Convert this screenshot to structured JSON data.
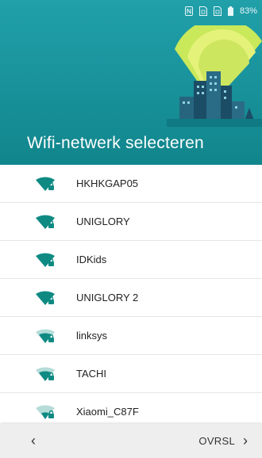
{
  "status_bar": {
    "battery_percent": "83%",
    "icons": [
      "nfc-icon",
      "sim-card-icon",
      "sim-card-icon",
      "battery-icon"
    ]
  },
  "header": {
    "title": "Wifi-netwerk selecteren",
    "background_color": "#1a96a0"
  },
  "networks": [
    {
      "ssid": "HKHKGAP05",
      "locked": true,
      "signal": 4
    },
    {
      "ssid": "UNIGLORY",
      "locked": true,
      "signal": 4
    },
    {
      "ssid": "IDKids",
      "locked": true,
      "signal": 4
    },
    {
      "ssid": "UNIGLORY 2",
      "locked": true,
      "signal": 4
    },
    {
      "ssid": "linksys",
      "locked": true,
      "signal": 3
    },
    {
      "ssid": "TACHI",
      "locked": true,
      "signal": 3
    },
    {
      "ssid": "Xiaomi_C87F",
      "locked": true,
      "signal": 2
    }
  ],
  "navbar": {
    "back_label": "‹",
    "next_label": "OVRSL",
    "next_chevron": "›"
  },
  "colors": {
    "accent": "#11858c",
    "wifi_strong": "#0e8a83",
    "wifi_weak": "#b5dcd9"
  }
}
